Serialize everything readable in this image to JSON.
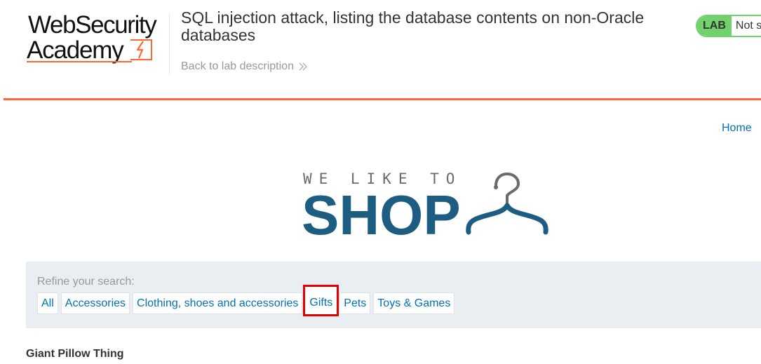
{
  "academy": {
    "logo_line1": "WebSecurity",
    "logo_line2": "Academy",
    "lab_title": "SQL injection attack, listing the database contents on non-Oracle databases",
    "back_link": "Back to lab description",
    "status_label": "LAB",
    "status_value": "Not solved",
    "accent_color": "#ff6633",
    "status_color": "#70d16d"
  },
  "shop": {
    "home_link": "Home",
    "logo_tagline": "WE LIKE TO",
    "logo_word": "SHOP",
    "brand_color": "#1d5d81",
    "link_color": "#0071bc"
  },
  "filters": {
    "title": "Refine your search:",
    "items": [
      "All",
      "Accessories",
      "Clothing, shoes and accessories",
      "Gifts",
      "Pets",
      "Toys & Games"
    ],
    "highlighted": "Gifts"
  },
  "products": [
    {
      "name": "Giant Pillow Thing"
    }
  ]
}
